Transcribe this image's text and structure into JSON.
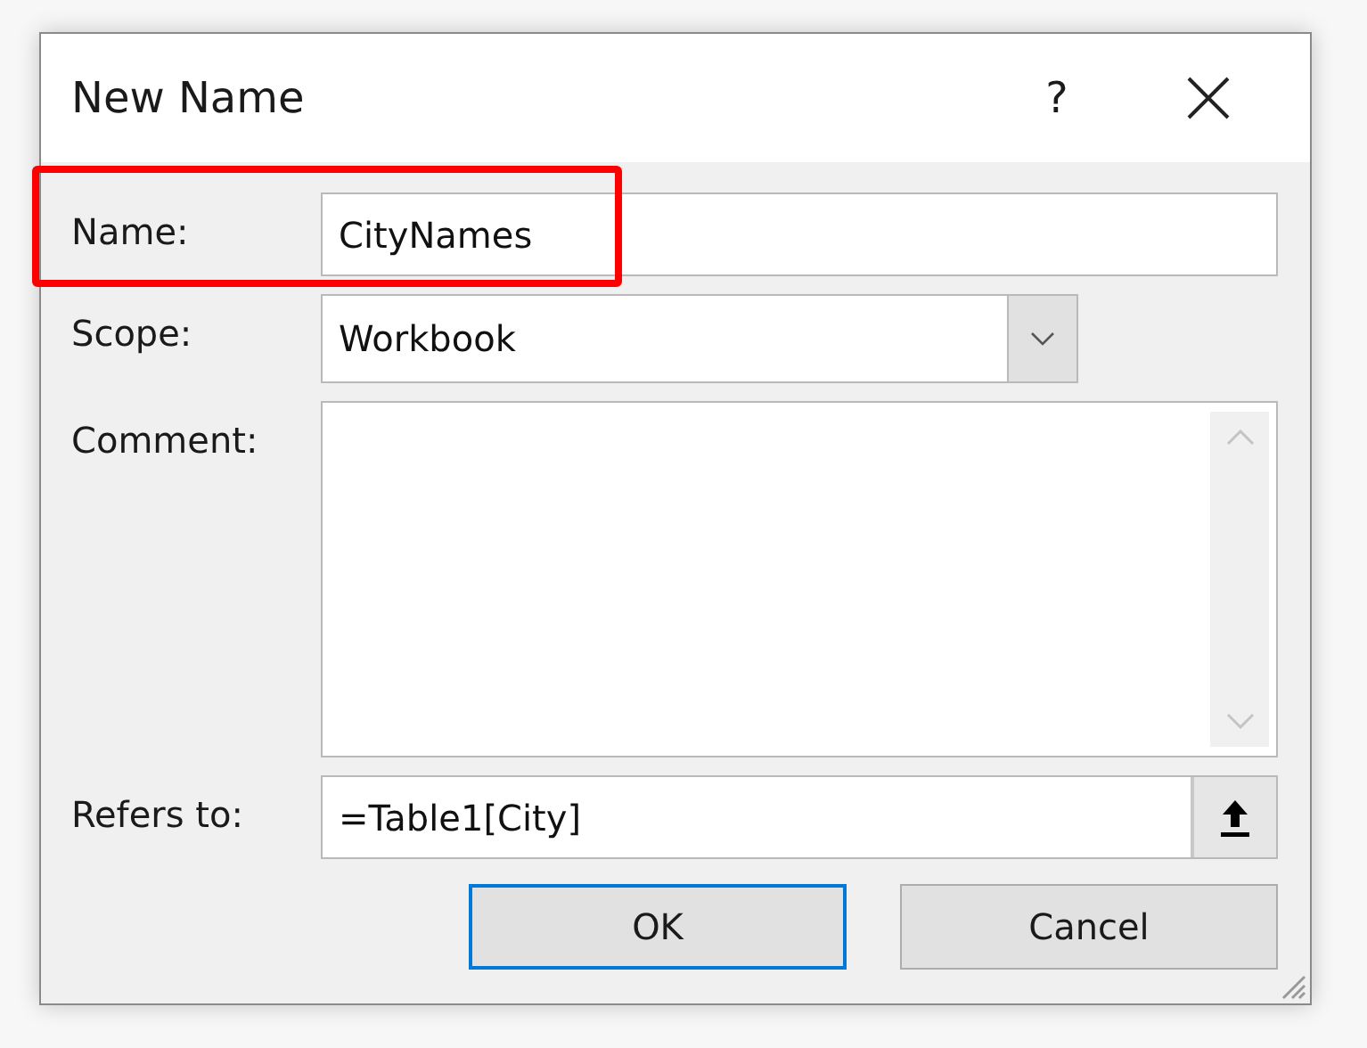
{
  "window": {
    "title": "New Name",
    "help": "?"
  },
  "fields": [
    {
      "label": "Name:",
      "kind": "text",
      "value": "CityNames",
      "highlighted": true
    },
    {
      "label": "Scope:",
      "kind": "dropdown",
      "value": "Workbook"
    },
    {
      "label": "Comment:",
      "kind": "textarea"
    },
    {
      "label": "Refers to:",
      "kind": "reference",
      "value": "=Table1[City]"
    }
  ],
  "buttons": [
    {
      "label": "OK",
      "focused": true
    },
    {
      "label": "Cancel",
      "focused": false
    }
  ]
}
